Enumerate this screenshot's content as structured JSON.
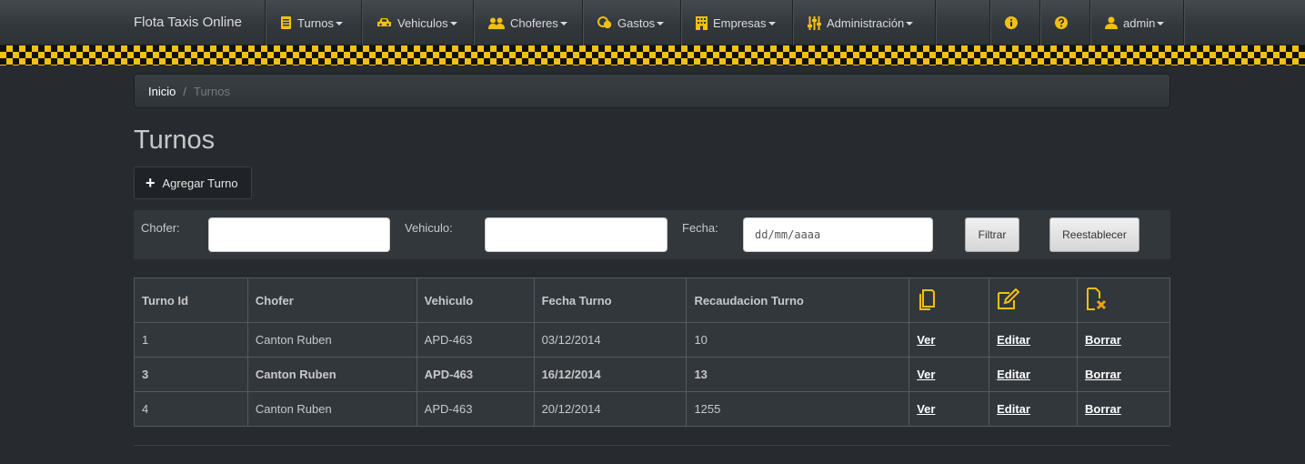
{
  "navbar": {
    "brand": "Flota Taxis Online",
    "menus": [
      {
        "label": "Turnos",
        "icon": "book-icon"
      },
      {
        "label": "Vehiculos",
        "icon": "car-icon"
      },
      {
        "label": "Choferes",
        "icon": "users-icon"
      },
      {
        "label": "Gastos",
        "icon": "coins-icon"
      },
      {
        "label": "Empresas",
        "icon": "building-icon"
      },
      {
        "label": "Administración",
        "icon": "sliders-icon"
      }
    ],
    "info_icon": "info-icon",
    "help_icon": "question-icon",
    "user_label": "admin"
  },
  "breadcrumb": {
    "home": "Inicio",
    "separator": "/",
    "current": "Turnos"
  },
  "page": {
    "title": "Turnos",
    "add_button": "Agregar Turno"
  },
  "filter": {
    "chofer_label": "Chofer:",
    "vehiculo_label": "Vehiculo:",
    "fecha_label": "Fecha:",
    "chofer_value": "",
    "vehiculo_value": "",
    "fecha_placeholder": "dd/mm/aaaa",
    "filter_button": "Filtrar",
    "reset_button": "Reestablecer"
  },
  "table": {
    "headers": [
      "Turno Id",
      "Chofer",
      "Vehiculo",
      "Fecha Turno",
      "Recaudacion Turno"
    ],
    "action_icons": [
      "copy-icon",
      "edit-icon",
      "delete-file-icon"
    ],
    "action_labels": {
      "view": "Ver",
      "edit": "Editar",
      "delete": "Borrar"
    },
    "rows": [
      {
        "id": "1",
        "chofer": "Canton Ruben",
        "vehiculo": "APD-463",
        "fecha": "03/12/2014",
        "recaudacion": "10"
      },
      {
        "id": "3",
        "chofer": "Canton Ruben",
        "vehiculo": "APD-463",
        "fecha": "16/12/2014",
        "recaudacion": "13"
      },
      {
        "id": "4",
        "chofer": "Canton Ruben",
        "vehiculo": "APD-463",
        "fecha": "20/12/2014",
        "recaudacion": "1255"
      }
    ]
  },
  "colors": {
    "accent": "#f2c010",
    "background": "#272b30",
    "panel": "#32373c"
  }
}
